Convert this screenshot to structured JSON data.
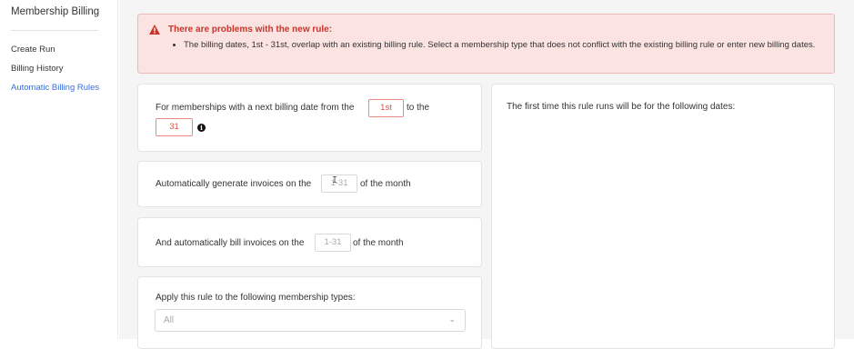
{
  "sidebar": {
    "title": "Membership Billing",
    "items": [
      {
        "label": "Create Run",
        "active": false
      },
      {
        "label": "Billing History",
        "active": false
      },
      {
        "label": "Automatic Billing Rules",
        "active": true
      }
    ]
  },
  "alert": {
    "title": "There are problems with the new rule:",
    "messages": [
      "The billing dates, 1st - 31st, overlap with an existing billing rule. Select a membership type that does not conflict with the existing billing rule or enter new billing dates."
    ],
    "color": "#c7352c"
  },
  "rule": {
    "from_prefix": "For memberships with a next billing date from the",
    "from_value": "1st",
    "to_text": "to the",
    "to_value": "31",
    "generate_prefix": "Automatically generate invoices on the",
    "generate_placeholder": "1-31",
    "generate_suffix": "of the month",
    "bill_prefix": "And automatically bill invoices on the",
    "bill_placeholder": "1-31",
    "bill_suffix": "of the month",
    "membership_label": "Apply this rule to the following membership types:",
    "membership_value": "All"
  },
  "preview": {
    "heading": "The first time this rule runs will be for the following dates:"
  },
  "colors": {
    "accent": "#3a6fd8",
    "error_border": "#e98a84",
    "alert_bg": "#fbe3e2"
  }
}
